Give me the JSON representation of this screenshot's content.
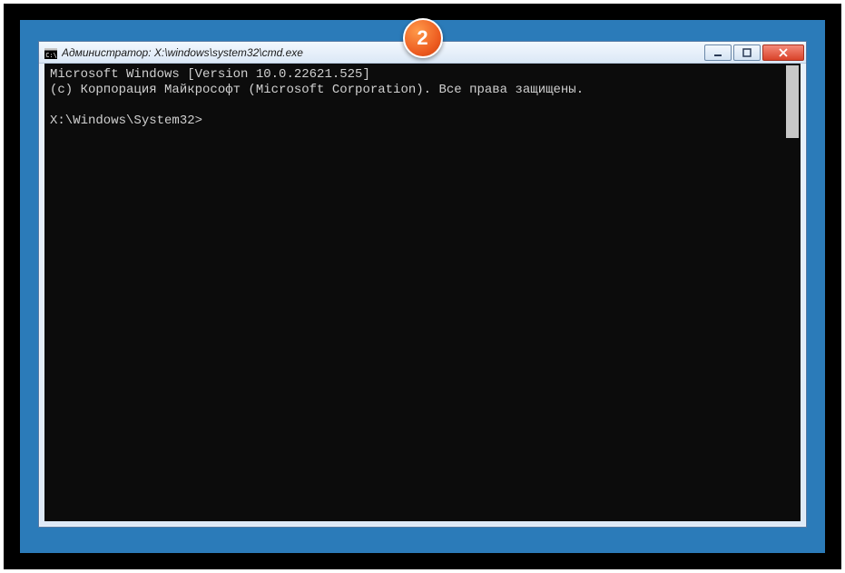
{
  "annotation": {
    "number": "2"
  },
  "window": {
    "title": "Администратор: X:\\windows\\system32\\cmd.exe"
  },
  "terminal": {
    "line1": "Microsoft Windows [Version 10.0.22621.525]",
    "line2": "(c) Корпорация Майкрософт (Microsoft Corporation). Все права защищены.",
    "blank": "",
    "prompt": "X:\\Windows\\System32>"
  }
}
